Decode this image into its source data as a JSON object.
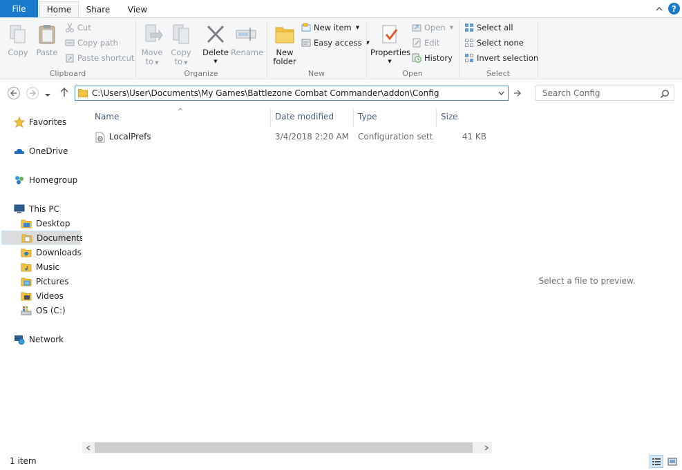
{
  "tabs": {
    "file": "File",
    "home": "Home",
    "share": "Share",
    "view": "View"
  },
  "help": "?",
  "ribbon": {
    "clipboard": {
      "label": "Clipboard",
      "copy": "Copy",
      "paste": "Paste",
      "cut": "Cut",
      "copy_path": "Copy path",
      "paste_shortcut": "Paste shortcut"
    },
    "organize": {
      "label": "Organize",
      "move_to": [
        "Move",
        "to"
      ],
      "copy_to": [
        "Copy",
        "to"
      ],
      "delete": "Delete",
      "rename": "Rename"
    },
    "new": {
      "label": "New",
      "new_folder": [
        "New",
        "folder"
      ],
      "new_item": "New item",
      "easy_access": "Easy access"
    },
    "open": {
      "label": "Open",
      "properties": "Properties",
      "open": "Open",
      "edit": "Edit",
      "history": "History"
    },
    "select": {
      "label": "Select",
      "select_all": "Select all",
      "select_none": "Select none",
      "invert_selection": "Invert selection"
    }
  },
  "address": {
    "path": "C:\\Users\\User\\Documents\\My Games\\Battlezone Combat Commander\\addon\\Config"
  },
  "search": {
    "placeholder": "Search Config"
  },
  "nav": {
    "favorites": "Favorites",
    "onedrive": "OneDrive",
    "homegroup": "Homegroup",
    "this_pc": "This PC",
    "desktop": "Desktop",
    "documents": "Documents",
    "downloads": "Downloads",
    "music": "Music",
    "pictures": "Pictures",
    "videos": "Videos",
    "os_c": "OS (C:)",
    "network": "Network"
  },
  "columns": {
    "name": "Name",
    "date_modified": "Date modified",
    "type": "Type",
    "size": "Size"
  },
  "files": [
    {
      "name": "LocalPrefs",
      "date_modified": "3/4/2018 2:20 AM",
      "type": "Configuration sett...",
      "size": "41 KB"
    }
  ],
  "preview_text": "Select a file to preview.",
  "status": {
    "item_count": "1 item"
  },
  "colors": {
    "accent": "#1979ca",
    "selected_nav": "#dcdcdc",
    "folder": "#f1c244"
  }
}
